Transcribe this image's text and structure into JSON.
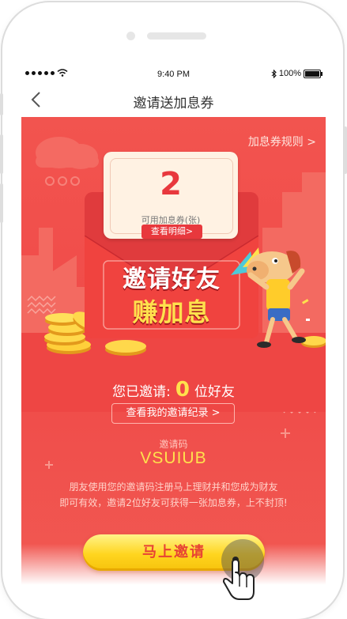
{
  "statusbar": {
    "time": "9:40 PM",
    "battery_text": "100%",
    "battery_level": 1.0,
    "icons": [
      "signal-dots-icon",
      "wifi-icon",
      "bluetooth-icon",
      "battery-icon"
    ]
  },
  "navbar": {
    "title": "邀请送加息券",
    "back_icon": "chevron-left-icon"
  },
  "rules_link": "加息券规则 >",
  "card": {
    "count": "2",
    "label": "可用加息券(张)",
    "detail_button": "查看明细>"
  },
  "headline": {
    "line1": "邀请好友",
    "line2": "赚加息"
  },
  "invited": {
    "prefix": "您已邀请:",
    "count": "0",
    "suffix": "位好友"
  },
  "record_button": "查看我的邀请纪录 >",
  "invite_code": {
    "label": "邀请码",
    "value": "VSUIUB"
  },
  "description": {
    "line1": "朋友使用您的邀请码注册马上理财并和您成为财友",
    "line2": "即可有效，邀请2位好友可获得一张加息券，上不封顶!"
  },
  "invite_button": "马上邀请",
  "colors": {
    "background_red": "#f04a48",
    "accent_yellow": "#ffe14d",
    "button_text": "#e74234"
  }
}
